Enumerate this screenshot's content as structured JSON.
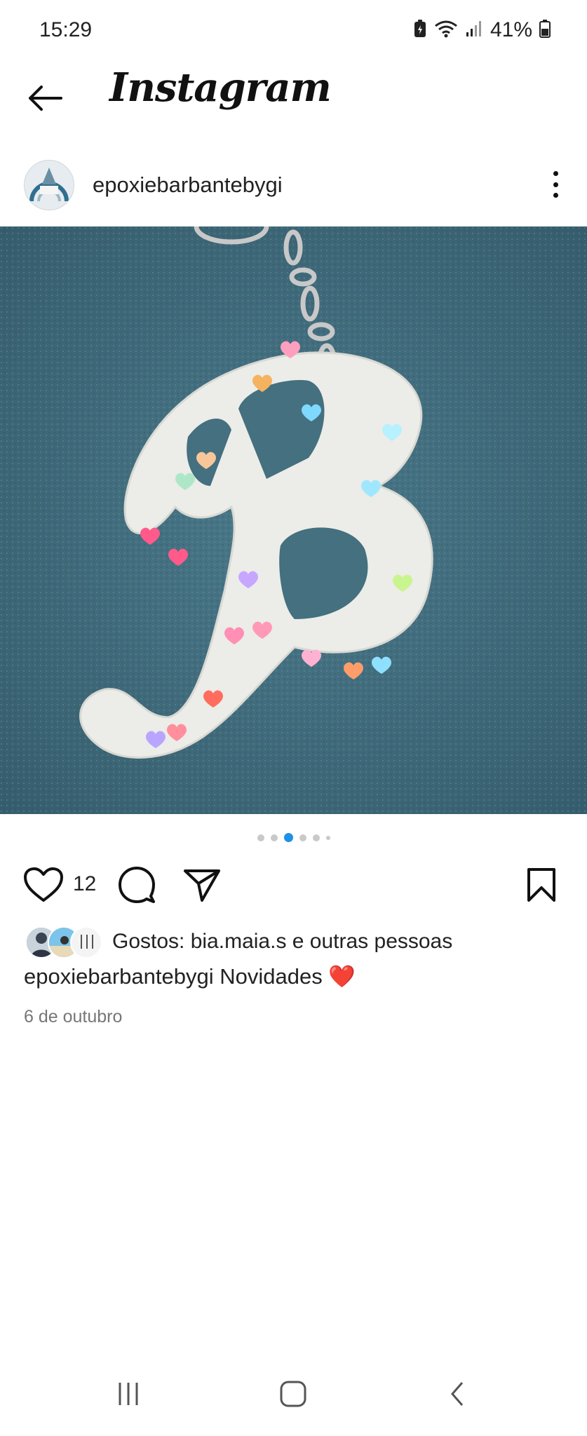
{
  "status_bar": {
    "time": "15:29",
    "battery_percent": "41%",
    "icons": [
      "battery-saver-icon",
      "wifi-icon",
      "signal-icon",
      "battery-icon"
    ]
  },
  "header": {
    "app_title": "Instagram",
    "back_icon": "arrow-left-icon"
  },
  "post": {
    "username": "epoxiebarbantebygi",
    "more_icon": "more-vertical-icon",
    "image_description_icon": "photo",
    "carousel": {
      "count": 6,
      "active_index": 2
    },
    "like_count": "12",
    "likes_text": "Gostos: bia.maia.s e outras pessoas",
    "caption_user": "epoxiebarbantebygi",
    "caption_text": "Novidades",
    "caption_emoji": "❤️",
    "date": "6 de outubro"
  },
  "actions": [
    "heart-icon",
    "comment-icon",
    "share-icon",
    "bookmark-icon"
  ],
  "nav_bar": [
    "recent-apps-icon",
    "home-icon",
    "back-icon"
  ],
  "colors": {
    "accent": "#1e90e6",
    "background": "#ffffff",
    "fabric": "#3f6878"
  }
}
